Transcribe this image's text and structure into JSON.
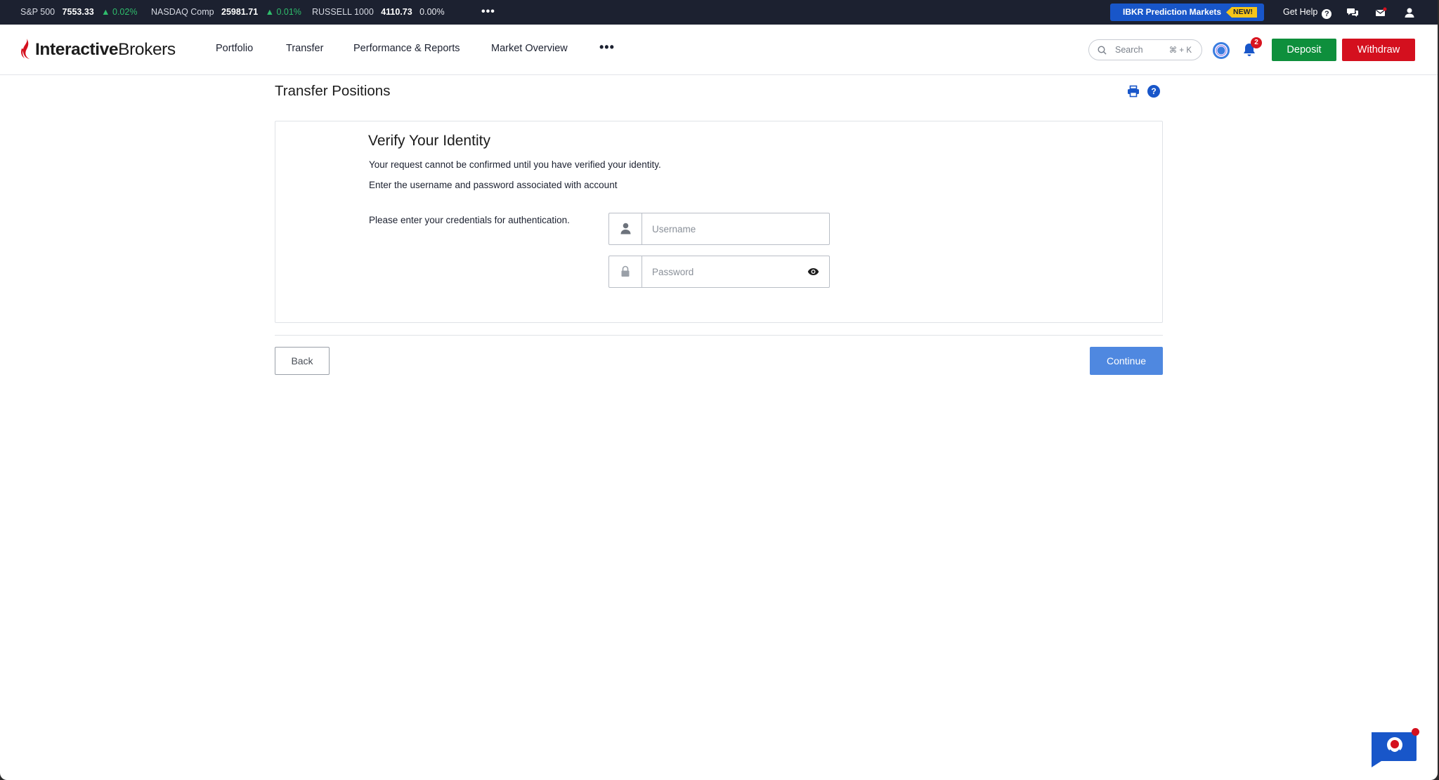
{
  "ticker": {
    "items": [
      {
        "name": "S&P 500",
        "value": "7553.33",
        "change": "▲ 0.02%",
        "direction": "up"
      },
      {
        "name": "NASDAQ Comp",
        "value": "25981.71",
        "change": "▲ 0.01%",
        "direction": "up"
      },
      {
        "name": "RUSSELL 1000",
        "value": "4110.73",
        "change": "0.00%",
        "direction": "flat"
      }
    ],
    "more": "•••",
    "promo_label": "IBKR Prediction Markets",
    "promo_badge": "NEW!",
    "get_help": "Get Help",
    "help_glyph": "?"
  },
  "nav": {
    "logo_bold": "Interactive",
    "logo_regular": "Brokers",
    "items": [
      "Portfolio",
      "Transfer",
      "Performance & Reports",
      "Market Overview"
    ],
    "more": "•••",
    "search_placeholder": "Search",
    "search_shortcut": "⌘ + K",
    "notification_count": "2",
    "deposit": "Deposit",
    "withdraw": "Withdraw"
  },
  "page": {
    "title": "Transfer Positions",
    "help_glyph": "?"
  },
  "verify": {
    "title": "Verify Your Identity",
    "line1": "Your request cannot be confirmed until you have verified your identity.",
    "line2": "Enter the username and password associated with account",
    "credentials_label": "Please enter your credentials for authentication.",
    "username_placeholder": "Username",
    "password_placeholder": "Password"
  },
  "actions": {
    "back": "Back",
    "continue": "Continue"
  },
  "colors": {
    "ticker_bg": "#1c2130",
    "up": "#2fbd6c",
    "brand_red": "#d4101e",
    "deposit_green": "#0e8f3c",
    "continue_blue": "#4f88e0",
    "promo_blue": "#1856c9"
  }
}
